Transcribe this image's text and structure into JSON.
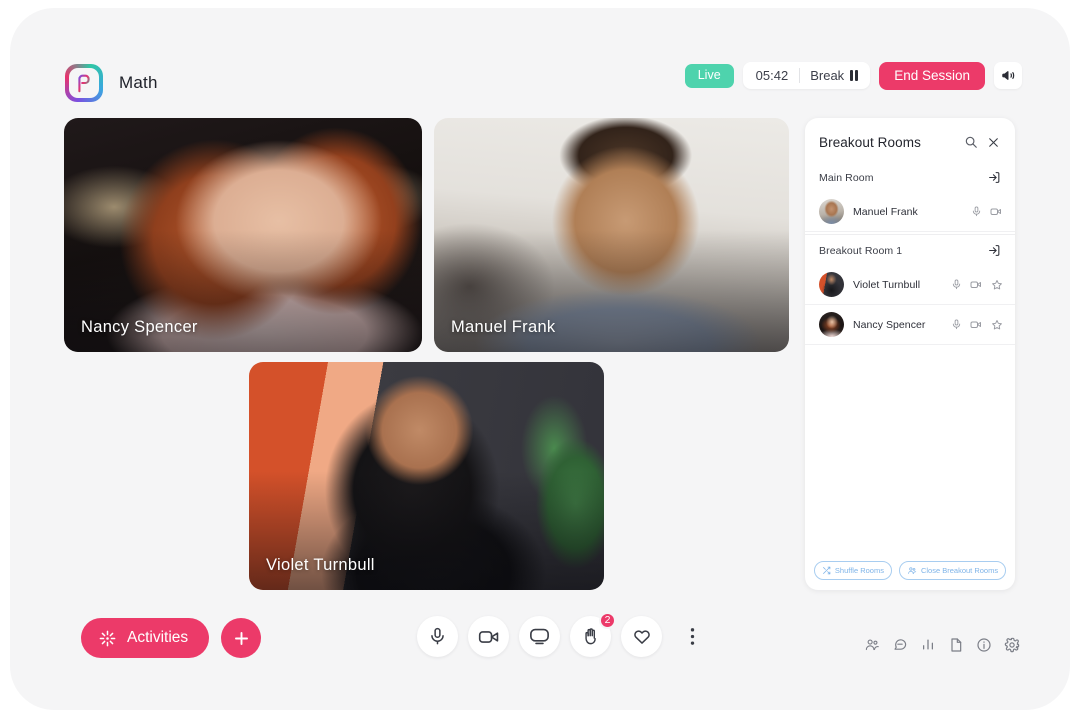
{
  "app": {
    "logo_name": "pronto-logo-icon",
    "session_title": "Math"
  },
  "session_controls": {
    "live_label": "Live",
    "timer": "05:42",
    "break_label": "Break",
    "end_session_label": "End Session",
    "announce_icon": "megaphone-icon",
    "live_color": "#4ed3ad",
    "end_session_color": "#ec3a69"
  },
  "video_tiles": [
    {
      "name": "Nancy Spencer"
    },
    {
      "name": "Manuel Frank"
    },
    {
      "name": "Violet Turnbull"
    }
  ],
  "breakout_panel": {
    "title": "Breakout Rooms",
    "search_icon": "search-icon",
    "close_icon": "close-icon",
    "rooms": [
      {
        "name": "Main Room",
        "enter_icon": "enter-room-icon",
        "participants": [
          {
            "name": "Manuel Frank",
            "mic_icon": "microphone-icon",
            "video_icon": "video-off-icon",
            "star_icon": null
          }
        ]
      },
      {
        "name": "Breakout Room 1",
        "enter_icon": "enter-room-icon",
        "participants": [
          {
            "name": "Violet Turnbull",
            "mic_icon": "microphone-icon",
            "video_icon": "video-off-icon",
            "star_icon": "star-icon"
          },
          {
            "name": "Nancy Spencer",
            "mic_icon": "microphone-icon",
            "video_icon": "video-off-icon",
            "star_icon": "star-icon"
          }
        ]
      }
    ],
    "actions": {
      "shuffle_label": "Shuffle Rooms",
      "close_rooms_label": "Close Breakout Rooms"
    },
    "action_color": "#7fb4e8"
  },
  "bottom_bar": {
    "activities_label": "Activities",
    "activities_icon": "sparkle-icon",
    "add_icon": "plus-icon",
    "media": [
      {
        "icon": "microphone-icon",
        "badge": null
      },
      {
        "icon": "video-camera-icon",
        "badge": null
      },
      {
        "icon": "screen-share-icon",
        "badge": null
      },
      {
        "icon": "raised-hand-icon",
        "badge": "2"
      },
      {
        "icon": "heart-icon",
        "badge": null
      },
      {
        "icon": "more-options-icon",
        "badge": null
      }
    ],
    "utilities": [
      {
        "icon": "people-icon"
      },
      {
        "icon": "chat-icon"
      },
      {
        "icon": "poll-icon"
      },
      {
        "icon": "file-icon"
      },
      {
        "icon": "info-icon"
      },
      {
        "icon": "settings-gear-icon"
      }
    ]
  }
}
